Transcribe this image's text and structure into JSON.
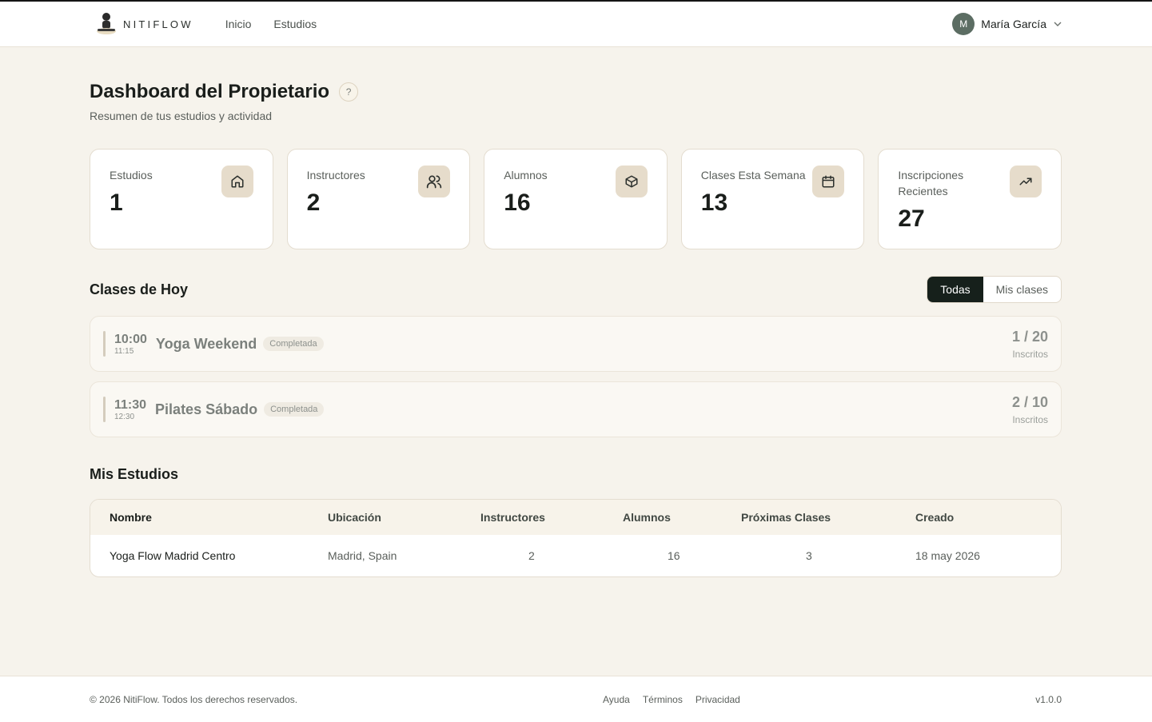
{
  "header": {
    "brand": "NITIFLOW",
    "nav": [
      "Inicio",
      "Estudios"
    ],
    "user": {
      "initial": "M",
      "name": "María García"
    }
  },
  "page": {
    "title": "Dashboard del Propietario",
    "help": "?",
    "subtitle": "Resumen de tus estudios y actividad"
  },
  "stats": [
    {
      "label": "Estudios",
      "value": "1",
      "icon": "home-icon"
    },
    {
      "label": "Instructores",
      "value": "2",
      "icon": "users-icon"
    },
    {
      "label": "Alumnos",
      "value": "16",
      "icon": "box-icon"
    },
    {
      "label": "Clases Esta Semana",
      "value": "13",
      "icon": "calendar-icon"
    },
    {
      "label": "Inscripciones Recientes",
      "value": "27",
      "icon": "trending-up-icon"
    }
  ],
  "today": {
    "title": "Clases de Hoy",
    "filters": [
      "Todas",
      "Mis clases"
    ],
    "active_filter": "Todas",
    "classes": [
      {
        "start": "10:00",
        "end": "11:15",
        "name": "Yoga Weekend",
        "status": "Completada",
        "enrolled": "1 / 20",
        "enrolled_label": "Inscritos"
      },
      {
        "start": "11:30",
        "end": "12:30",
        "name": "Pilates Sábado",
        "status": "Completada",
        "enrolled": "2 / 10",
        "enrolled_label": "Inscritos"
      }
    ]
  },
  "studios": {
    "title": "Mis Estudios",
    "columns": [
      "Nombre",
      "Ubicación",
      "Instructores",
      "Alumnos",
      "Próximas Clases",
      "Creado"
    ],
    "rows": [
      [
        "Yoga Flow Madrid Centro",
        "Madrid, Spain",
        "2",
        "16",
        "3",
        "18 may 2026"
      ]
    ]
  },
  "footer": {
    "copyright": "© 2026 NitiFlow. Todos los derechos reservados.",
    "links": [
      "Ayuda",
      "Términos",
      "Privacidad"
    ],
    "version": "v1.0.0"
  },
  "colors": {
    "accent_dark": "#16201b",
    "icon_bg": "#e6dccb",
    "background": "#f6f3ec"
  }
}
